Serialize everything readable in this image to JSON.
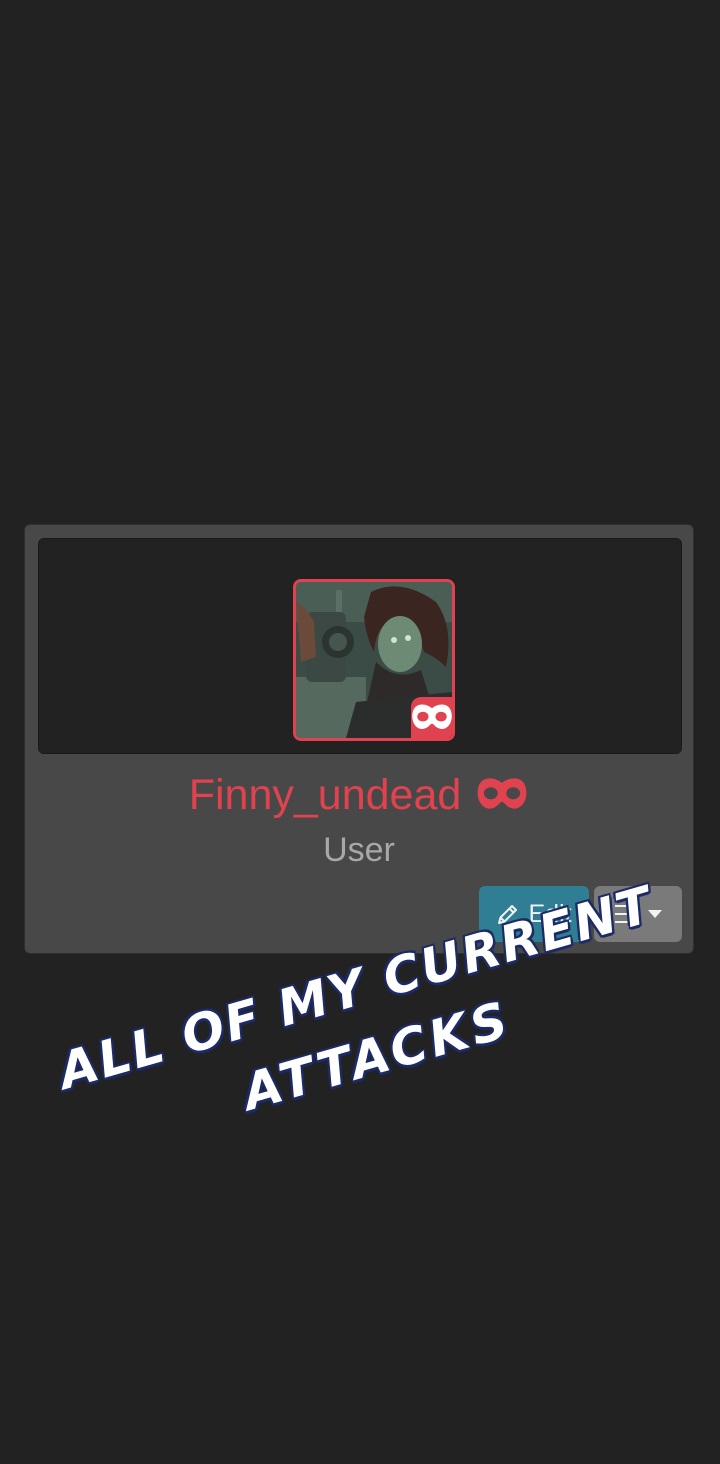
{
  "profile": {
    "username": "Finny_undead",
    "role": "User",
    "username_badge_icon": "mask-icon",
    "avatar_badge_icon": "mask-icon",
    "accent_color": "#e0434f"
  },
  "actions": {
    "edit_label": "Edit",
    "edit_icon": "pencil-icon",
    "menu_icon": "hamburger-icon",
    "menu_caret_icon": "caret-down-icon",
    "edit_color": "#2f7e94"
  },
  "overlay": {
    "line1": "ALL OF MY CURRENT",
    "line2": "ATTACKS"
  }
}
